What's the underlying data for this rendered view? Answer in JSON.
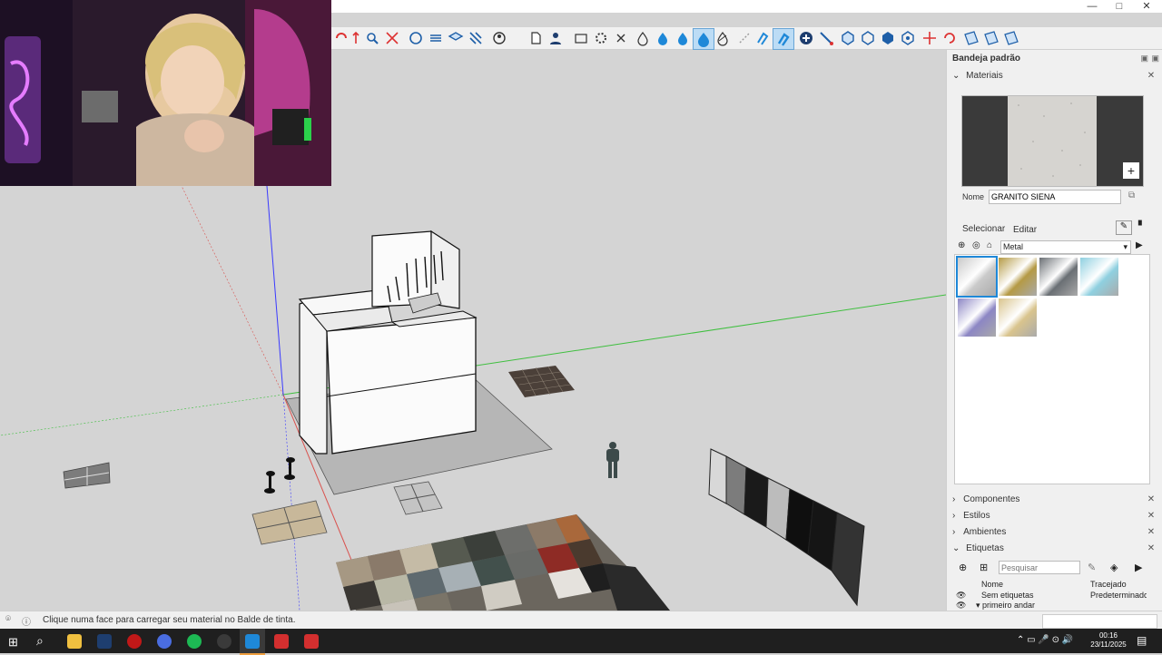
{
  "window": {
    "minimize": "—",
    "maximize": "□",
    "close": "✕"
  },
  "tray": {
    "title": "Bandeja padrão",
    "materials": {
      "header": "Materiais",
      "name_label": "Nome",
      "name_value": "GRANITO SIENA",
      "tab_select": "Selecionar",
      "tab_edit": "Editar",
      "library": "Metal",
      "swatches": [
        {
          "color": "#c9c9c9",
          "label": "metal-silver"
        },
        {
          "color": "#b59a45",
          "label": "metal-gold"
        },
        {
          "color": "#6a6f74",
          "label": "metal-dark"
        },
        {
          "color": "#8fd0e0",
          "label": "metal-cyan"
        },
        {
          "color": "#8c86c4",
          "label": "metal-violet"
        },
        {
          "color": "#d9c48d",
          "label": "metal-brass"
        }
      ]
    },
    "sections": [
      "Componentes",
      "Estilos",
      "Ambientes",
      "Etiquetas"
    ],
    "tags": {
      "search_placeholder": "Pesquisar",
      "col_name": "Nome",
      "col_dash": "Tracejado",
      "rows": [
        {
          "name": "Sem etiquetas",
          "dash": "Predeterminado"
        },
        {
          "name": "▾ primeiro andar",
          "dash": ""
        }
      ]
    }
  },
  "status": {
    "message": "Clique numa face para carregar seu material no Balde de tinta."
  },
  "clock": {
    "time": "00:16",
    "date": "23/11/2025"
  },
  "colors": {
    "accent": "#1e88d8",
    "axis_red": "#d9534f",
    "axis_green": "#3fbf3f",
    "axis_blue": "#3a3aff"
  }
}
